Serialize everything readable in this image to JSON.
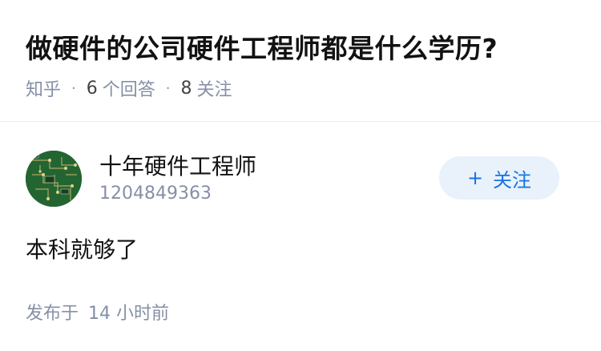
{
  "question": {
    "title": "做硬件的公司硬件工程师都是什么学历?",
    "source": "知乎",
    "answers_count": "6",
    "answers_label": "个回答",
    "followers_count": "8",
    "followers_label": "关注"
  },
  "answer": {
    "author_name": "十年硬件工程师",
    "author_id": "1204849363",
    "follow_button_label": "关注",
    "follow_button_icon": "plus-icon",
    "content": "本科就够了",
    "published_label": "发布于",
    "published_time": "14 小时前"
  },
  "colors": {
    "title": "#121212",
    "meta": "#8590a6",
    "accent": "#1772e6",
    "follow_bg": "#e9f2fb",
    "divider": "#ececec"
  }
}
